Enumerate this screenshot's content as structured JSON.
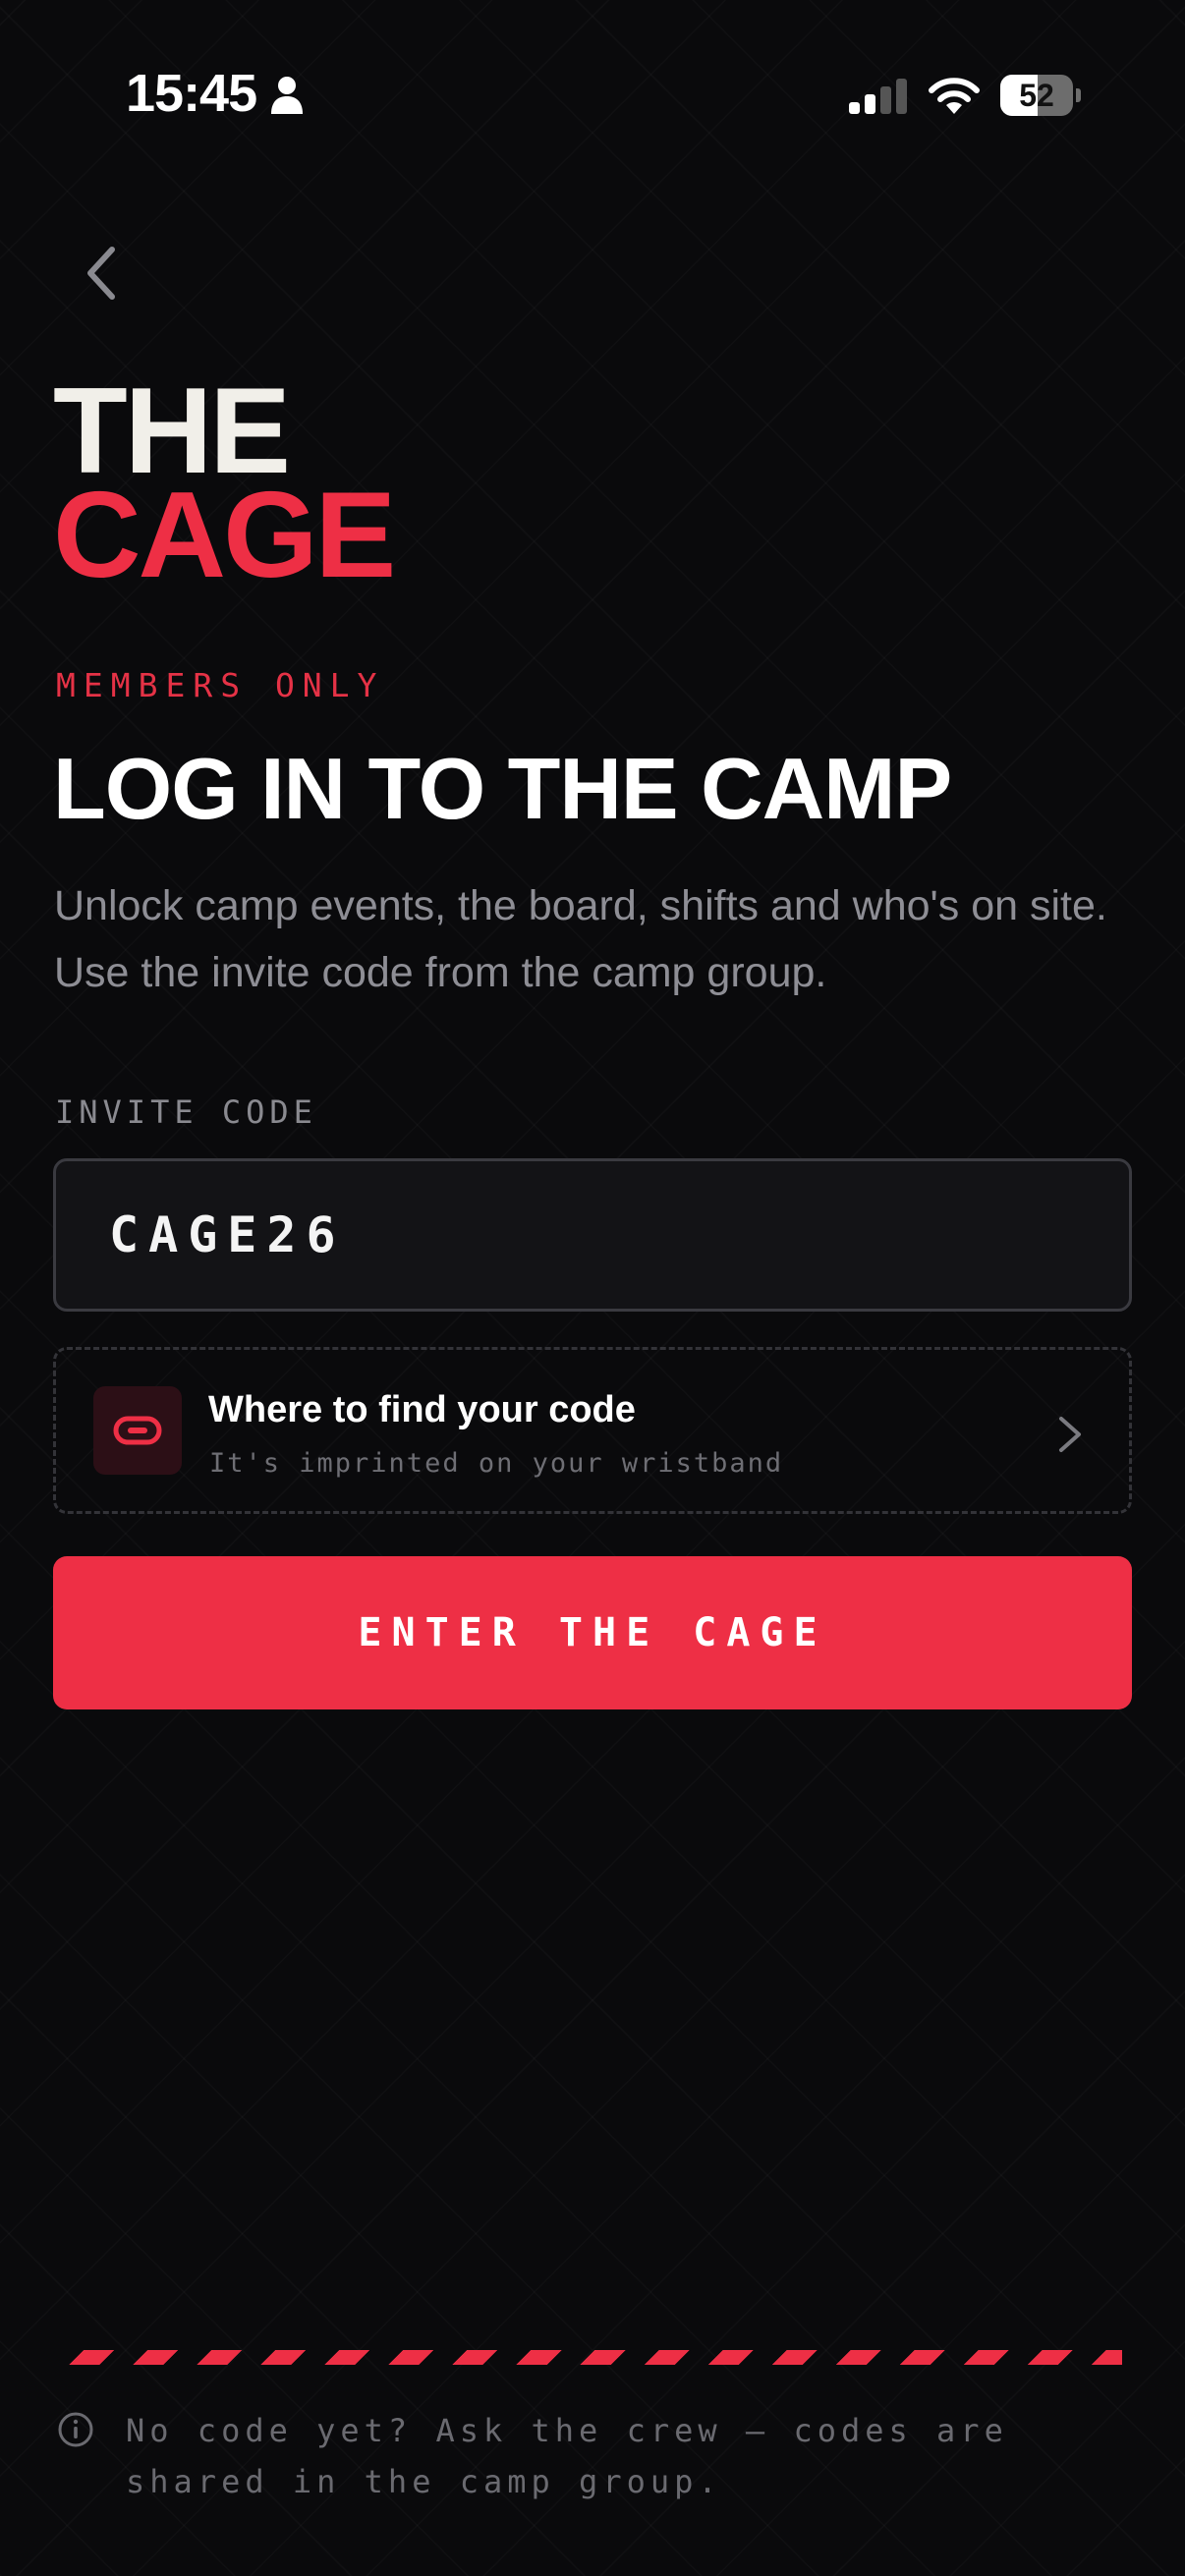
{
  "status_bar": {
    "time": "15:45",
    "battery_level": "52",
    "battery_percent": 52,
    "icons": [
      "person-icon",
      "signal-icon",
      "wifi-icon",
      "battery-icon"
    ]
  },
  "nav": {
    "back_icon": "chevron-left-icon"
  },
  "logo": {
    "line1": "THE",
    "line2": "CAGE"
  },
  "eyebrow": "MEMBERS ONLY",
  "headline": "LOG IN TO THE CAMP",
  "subtitle": "Unlock camp events, the board, shifts and who's on site. Use the invite code from the camp group.",
  "form": {
    "label": "INVITE CODE",
    "code_value": "CAGE26"
  },
  "help_card": {
    "icon": "wristband-icon",
    "title": "Where to find your code",
    "subtitle": "It's imprinted on your wristband"
  },
  "submit_label": "ENTER THE CAGE",
  "footer_note": "No code yet? Ask the crew — codes are shared in the camp group.",
  "colors": {
    "background": "#0a0a0c",
    "accent": "#ee2f45",
    "logo_light": "#f1efe9",
    "muted_text": "#8e8e95"
  }
}
